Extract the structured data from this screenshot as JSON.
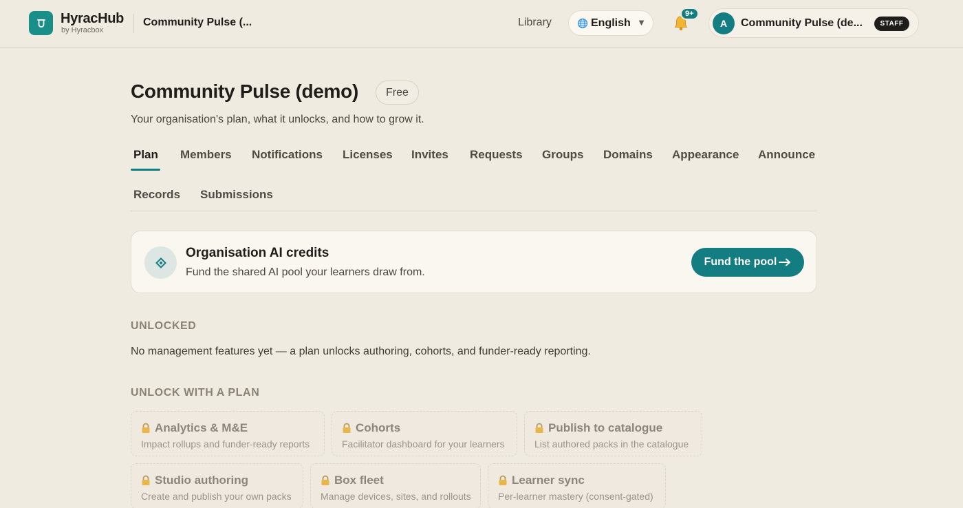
{
  "header": {
    "brand_name": "HyracHub",
    "brand_sub": "by Hyracbox",
    "org_crumb": "Community Pulse (...",
    "nav_library": "Library",
    "language": "English",
    "notifications_badge": "9+",
    "account_initial": "A",
    "account_name": "Community Pulse (de...",
    "account_role": "STAFF"
  },
  "page": {
    "title": "Community Pulse (demo)",
    "plan_badge": "Free",
    "subtitle": "Your organisation's plan, what it unlocks, and how to grow it."
  },
  "tabs": [
    {
      "label": "Plan",
      "active": true
    },
    {
      "label": "Members"
    },
    {
      "label": "Notifications"
    },
    {
      "label": "Licenses"
    },
    {
      "label": "Invites"
    },
    {
      "label": "Requests"
    },
    {
      "label": "Groups"
    },
    {
      "label": "Domains"
    },
    {
      "label": "Appearance"
    },
    {
      "label": "Announce"
    },
    {
      "label": "Records"
    },
    {
      "label": "Submissions"
    }
  ],
  "credits": {
    "title": "Organisation AI credits",
    "description": "Fund the shared AI pool your learners draw from.",
    "button": "Fund the pool"
  },
  "unlocked": {
    "label": "UNLOCKED",
    "text": "No management features yet — a plan unlocks authoring, cohorts, and funder-ready reporting."
  },
  "unlock_with_plan": {
    "label": "UNLOCK WITH A PLAN",
    "features": [
      {
        "title": "Analytics & M&E",
        "desc": "Impact rollups and funder-ready reports"
      },
      {
        "title": "Cohorts",
        "desc": "Facilitator dashboard for your learners"
      },
      {
        "title": "Publish to catalogue",
        "desc": "List authored packs in the catalogue"
      },
      {
        "title": "Studio authoring",
        "desc": "Create and publish your own packs"
      },
      {
        "title": "Box fleet",
        "desc": "Manage devices, sites, and rollouts"
      },
      {
        "title": "Learner sync",
        "desc": "Per-learner mastery (consent-gated)"
      }
    ]
  },
  "colors": {
    "accent": "#137d82",
    "background": "#f0ebe1"
  }
}
